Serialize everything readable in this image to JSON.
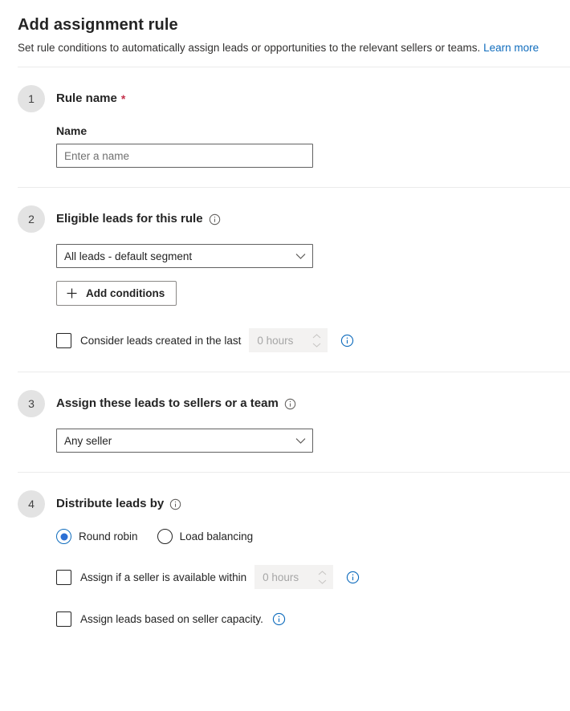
{
  "header": {
    "title": "Add assignment rule",
    "subtitle": "Set rule conditions to automatically assign leads or opportunities to the relevant sellers or teams.",
    "learn_more_label": "Learn more"
  },
  "colors": {
    "accent_blue": "#0f6cbd",
    "radio_blue": "#2b6fd4",
    "required_red": "#c4314b",
    "badge_grey": "#e3e3e3",
    "divider_grey": "#ebebeb",
    "disabled_bg": "#f3f2f1",
    "disabled_text": "#a6a6a6",
    "border_grey": "#616161"
  },
  "sections": [
    {
      "step": "1",
      "title": "Rule name",
      "required": true,
      "required_marker": "*",
      "field_label": "Name",
      "input_placeholder": "Enter a name",
      "input_value": ""
    },
    {
      "step": "2",
      "title": "Eligible leads for this rule",
      "info_icon": "info-icon",
      "select_value": "All leads - default segment",
      "add_conditions_label": "Add conditions",
      "add_conditions_icon": "plus-icon",
      "checkbox": {
        "label": "Consider leads created in the last",
        "checked": false,
        "spinner_value": "0 hours",
        "spinner_disabled": true,
        "info_icon": "info-icon"
      }
    },
    {
      "step": "3",
      "title": "Assign these leads to sellers or a team",
      "info_icon": "info-icon",
      "select_value": "Any seller"
    },
    {
      "step": "4",
      "title": "Distribute leads by",
      "info_icon": "info-icon",
      "radios": [
        {
          "label": "Round robin",
          "checked": true
        },
        {
          "label": "Load balancing",
          "checked": false
        }
      ],
      "checkbox_available": {
        "label": "Assign if a seller is available within",
        "checked": false,
        "spinner_value": "0 hours",
        "spinner_disabled": true,
        "info_icon": "info-icon"
      },
      "checkbox_capacity": {
        "label": "Assign leads based on seller capacity.",
        "checked": false,
        "info_icon": "info-icon"
      }
    }
  ]
}
